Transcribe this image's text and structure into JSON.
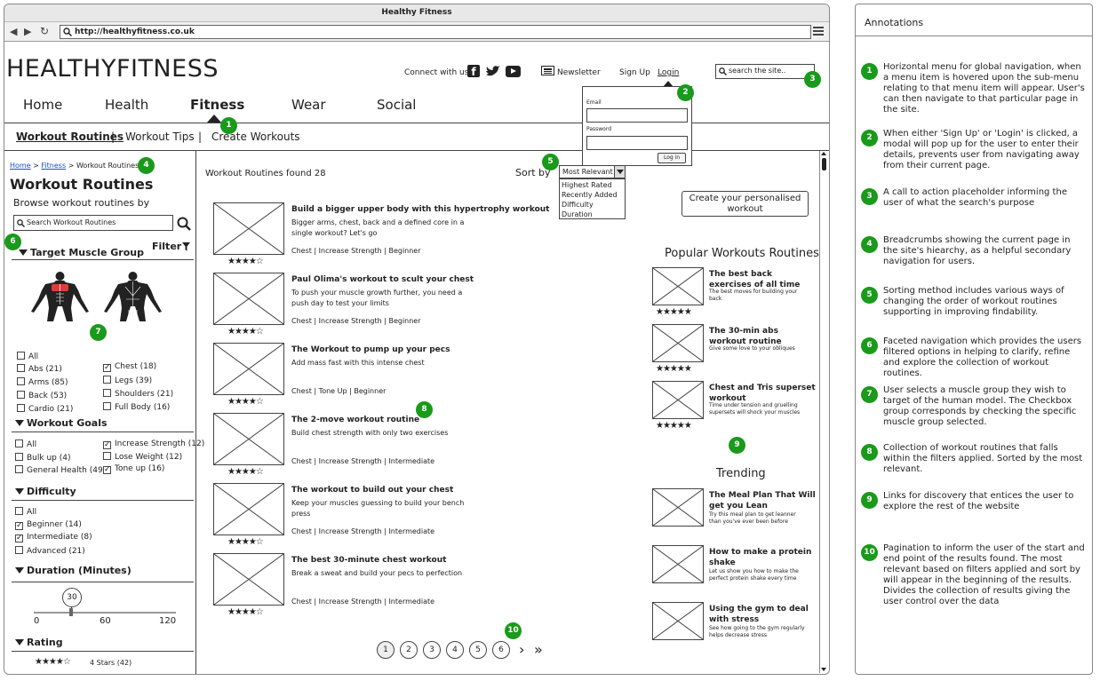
{
  "browser": {
    "title": "Healthy Fitness",
    "url": "http://healthyfitness.co.uk"
  },
  "header": {
    "logo": "HEALTHYFITNESS",
    "connect": "Connect with us",
    "newsletter": "Newsletter",
    "signup": "Sign Up",
    "login": "Login",
    "search_placeholder": "search the site.."
  },
  "nav": {
    "items": [
      "Home",
      "Health",
      "Fitness",
      "Wear",
      "Social"
    ],
    "active": "Fitness"
  },
  "subnav": [
    "Workout Routines",
    "Workout Tips",
    "Create Workouts"
  ],
  "login_modal": {
    "email_label": "Email",
    "password_label": "Password",
    "button": "Log in"
  },
  "breadcrumb": {
    "home": "Home",
    "fitness": "Fitness",
    "current": "Workout Routines"
  },
  "sidebar": {
    "title": "Workout Routines",
    "subtitle": "Browse workout routines by",
    "search_placeholder": "Search Workout Routines",
    "filter": "Filter",
    "muscle": {
      "title": "Target Muscle Group",
      "all": "All",
      "left": [
        "Abs (21)",
        "Arms (85)",
        "Back (53)",
        "Cardio (21)"
      ],
      "right": [
        "Chest (18)",
        "Legs (39)",
        "Shoulders (21)",
        "Full Body (16)"
      ]
    },
    "goals": {
      "title": "Workout Goals",
      "all": "All",
      "left": [
        "Bulk up (4)",
        "General Health (49)"
      ],
      "right": [
        "Increase Strength (12)",
        "Lose Weight (12)",
        "Tone up (16)"
      ]
    },
    "difficulty": {
      "title": "Difficulty",
      "items": [
        "All",
        "Beginner (14)",
        "Intermediate (8)",
        "Advanced (21)"
      ]
    },
    "duration": {
      "title": "Duration (Minutes)",
      "value": "30",
      "ticks": [
        "0",
        "60",
        "120"
      ]
    },
    "rating": {
      "title": "Rating",
      "label": "4 Stars (42)"
    }
  },
  "results": {
    "count": "Workout Routines found 28",
    "sort_label": "Sort by",
    "sort_selected": "Most Relevant",
    "sort_options": [
      "Highest Rated",
      "Recently Added",
      "Difficulty",
      "Duration"
    ],
    "items": [
      {
        "title": "Build a bigger upper body with this hypertrophy workout",
        "desc": "Bigger arms, chest, back and a defined core in a single workout? Let's go",
        "tags": "Chest | Increase Strength | Beginner"
      },
      {
        "title": "Paul Olima's workout to scult your chest",
        "desc": "To push your muscle growth further, you need a push day to test your limits",
        "tags": "Chest | Increase Strength | Beginner"
      },
      {
        "title": "The Workout to pump up your pecs",
        "desc": "Add mass fast with this intense chest",
        "tags": "Chest | Tone Up | Beginner"
      },
      {
        "title": "The 2-move workout routine",
        "desc": "Build chest strength with only two exercises",
        "tags": "Chest | Increase Strength | Intermediate"
      },
      {
        "title": "The workout to build out your chest",
        "desc": "Keep your muscles guessing to build your bench press",
        "tags": "Chest | Increase Strength | Intermediate"
      },
      {
        "title": "The best 30-minute chest workout",
        "desc": "Break a sweat and build your pecs to perfection",
        "tags": "Chest | Increase Strength | Intermediate"
      }
    ],
    "pages": [
      "1",
      "2",
      "3",
      "4",
      "5",
      "6"
    ]
  },
  "right": {
    "cta": "Create your personalised workout",
    "popular_title": "Popular Workouts Routines",
    "popular": [
      {
        "title": "The best back exercises of all time",
        "desc": "The best moves for building your back"
      },
      {
        "title": "The 30-min abs workout routine",
        "desc": "Give some love to your obliques"
      },
      {
        "title": "Chest and Tris superset workout",
        "desc": "Time under tension and gruelling supersets will shock your muscles"
      }
    ],
    "trending_title": "Trending",
    "trending": [
      {
        "title": "The Meal Plan That Will get you Lean",
        "desc": "Try this meal plan to get leanner than you've ever been before"
      },
      {
        "title": "How to make a protein shake",
        "desc": "Let us show you how to make the perfect protein shake every time"
      },
      {
        "title": "Using the gym to deal with stress",
        "desc": "See how going to the gym regularly helps decrease stress"
      }
    ]
  },
  "ratings": {
    "list_stars": 4,
    "popular_stars": 5,
    "max": 5
  },
  "annotations": {
    "title": "Annotations",
    "items": [
      "Horizontal menu for global navigation, when a menu item is hovered upon the sub-menu relating to that menu item will appear. User's can then navigate to that particular page in the site.",
      "When either 'Sign Up' or 'Login' is clicked, a modal will pop up for the user to enter their details, prevents user from navigating away from their current page.",
      "A call to action placeholder informing the user of what the search's purpose",
      "Breadcrumbs showing the current page in the site's hiearchy, as a helpful secondary navigation for users.",
      "Sorting method includes various ways of changing the order of workout routines supporting in improving findability.",
      "Faceted navigation which provides the users filtered options in helping to clarify, refine and explore the collection of workout routines.",
      "User selects a muscle group they wish to target of the human model. The Checkbox group corresponds by checking the specific muscle group selected.",
      "Collection of workout routines that falls within the filters applied. Sorted by the most relevant.",
      "Links for discovery that entices the user to explore the rest of the website",
      "Pagination to inform the user of the start and end point of the results found. The most relevant based on filters applied and sort by will appear in the beginning of the results. Divides the collection of results giving the user control over the data"
    ],
    "numbers": [
      "1",
      "2",
      "3",
      "4",
      "5",
      "6",
      "7",
      "8",
      "9",
      "10"
    ]
  }
}
